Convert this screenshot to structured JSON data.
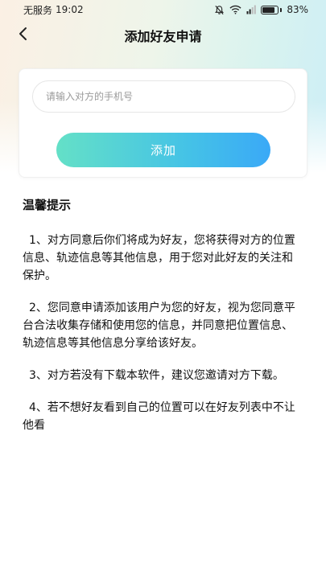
{
  "status_bar": {
    "carrier": "无服务",
    "time": "19:02",
    "battery": "83%",
    "battery_level": 0.83,
    "icons": [
      "mute-bell-icon",
      "wifi-icon",
      "signal-icon",
      "battery-icon"
    ]
  },
  "header": {
    "title": "添加好友申请",
    "back_icon": "chevron-left-icon"
  },
  "form": {
    "phone_placeholder": "请输入对方的手机号",
    "phone_value": "",
    "add_label": "添加"
  },
  "tips": {
    "title": "温馨提示",
    "items": [
      "1、对方同意后你们将成为好友，您将获得对方的位置信息、轨迹信息等其他信息，用于您对此好友的关注和保护。",
      "2、您同意申请添加该用户为您的好友，视为您同意平台合法收集存储和使用您的信息，并同意把位置信息、轨迹信息等其他信息分享给该好友。",
      "3、对方若没有下载本软件，建议您邀请对方下载。",
      "4、若不想好友看到自己的位置可以在好友列表中不让他看"
    ]
  },
  "colors": {
    "button_start": "#64e0c7",
    "button_end": "#3aa9f7",
    "text": "#111111"
  }
}
